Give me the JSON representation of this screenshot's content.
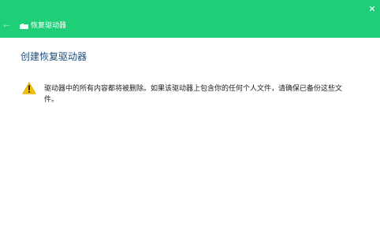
{
  "window": {
    "title": "恢复驱动器",
    "close_icon": "close-icon",
    "back_icon": "back-arrow-icon",
    "drive_icon": "drive-icon",
    "accent_color": "#1fcf78"
  },
  "main": {
    "heading": "创建恢复驱动器",
    "warning_icon": "warning-icon",
    "warning_text": "驱动器中的所有内容都将被删除。如果该驱动器上包含你的任何个人文件，请确保已备份这些文件。"
  }
}
